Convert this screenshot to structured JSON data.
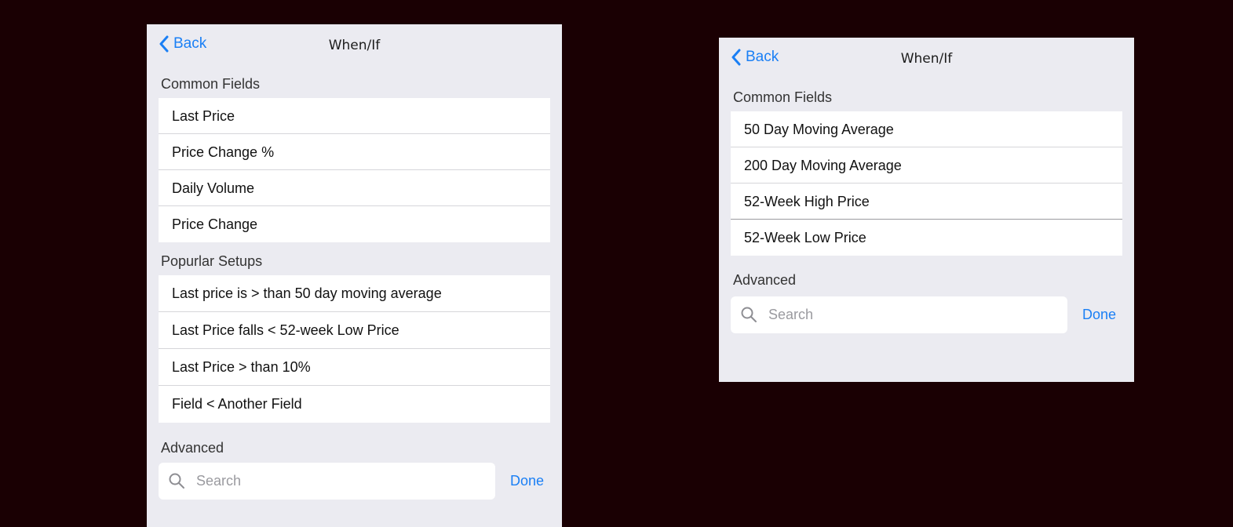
{
  "panels": [
    {
      "back_label": "Back",
      "title": "When/If",
      "common_header": "Common Fields",
      "common_items": [
        "Last Price",
        "Price Change %",
        "Daily Volume",
        "Price Change"
      ],
      "popular_header": "Popurlar Setups",
      "popular_items": [
        "Last price is > than 50 day moving average",
        "Last Price falls < 52-week Low Price",
        "Last Price > than 10%",
        "Field < Another Field"
      ],
      "advanced_header": "Advanced",
      "search_placeholder": "Search",
      "done_label": "Done"
    },
    {
      "back_label": "Back",
      "title": "When/If",
      "common_header": "Common Fields",
      "common_items": [
        "50 Day Moving Average",
        "200 Day Moving Average",
        "52-Week High Price",
        "52-Week Low Price"
      ],
      "advanced_header": "Advanced",
      "search_placeholder": "Search",
      "done_label": "Done"
    }
  ],
  "colors": {
    "background": "#1a0003",
    "panel": "#ebebf1",
    "accent": "#1a7ff5"
  },
  "icons": [
    "chevron-left-icon",
    "search-icon"
  ]
}
